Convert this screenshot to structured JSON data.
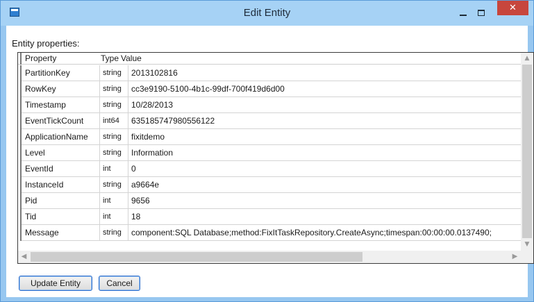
{
  "window": {
    "title": "Edit Entity",
    "close_glyph": "✕"
  },
  "panel": {
    "label": "Entity properties:"
  },
  "grid": {
    "columns": [
      "Property",
      "Type",
      "Value"
    ],
    "rows": [
      {
        "property": "PartitionKey",
        "type": "string",
        "value": "2013102816"
      },
      {
        "property": "RowKey",
        "type": "string",
        "value": "cc3e9190-5100-4b1c-99df-700f419d6d00"
      },
      {
        "property": "Timestamp",
        "type": "string",
        "value": "10/28/2013"
      },
      {
        "property": "EventTickCount",
        "type": "int64",
        "value": "635185747980556122"
      },
      {
        "property": "ApplicationName",
        "type": "string",
        "value": "fixitdemo"
      },
      {
        "property": "Level",
        "type": "string",
        "value": "Information"
      },
      {
        "property": "EventId",
        "type": "int",
        "value": "0"
      },
      {
        "property": "InstanceId",
        "type": "string",
        "value": "a9664e"
      },
      {
        "property": "Pid",
        "type": "int",
        "value": "9656"
      },
      {
        "property": "Tid",
        "type": "int",
        "value": "18"
      },
      {
        "property": "Message",
        "type": "string",
        "value": "component:SQL Database;method:FixItTaskRepository.CreateAsync;timespan:00:00:00.0137490;"
      }
    ]
  },
  "buttons": {
    "update": "Update Entity",
    "cancel": "Cancel"
  },
  "icons": {
    "app": "window-app-icon",
    "minimize": "minimize-icon",
    "maximize": "maximize-icon",
    "close": "close-icon",
    "scroll_up": "chevron-up-icon",
    "scroll_down": "chevron-down-icon",
    "scroll_left": "chevron-left-icon",
    "scroll_right": "chevron-right-icon"
  },
  "colors": {
    "titlebar": "#a6d2f5",
    "close_button": "#c7463d",
    "button_border": "#2d6ecb"
  }
}
